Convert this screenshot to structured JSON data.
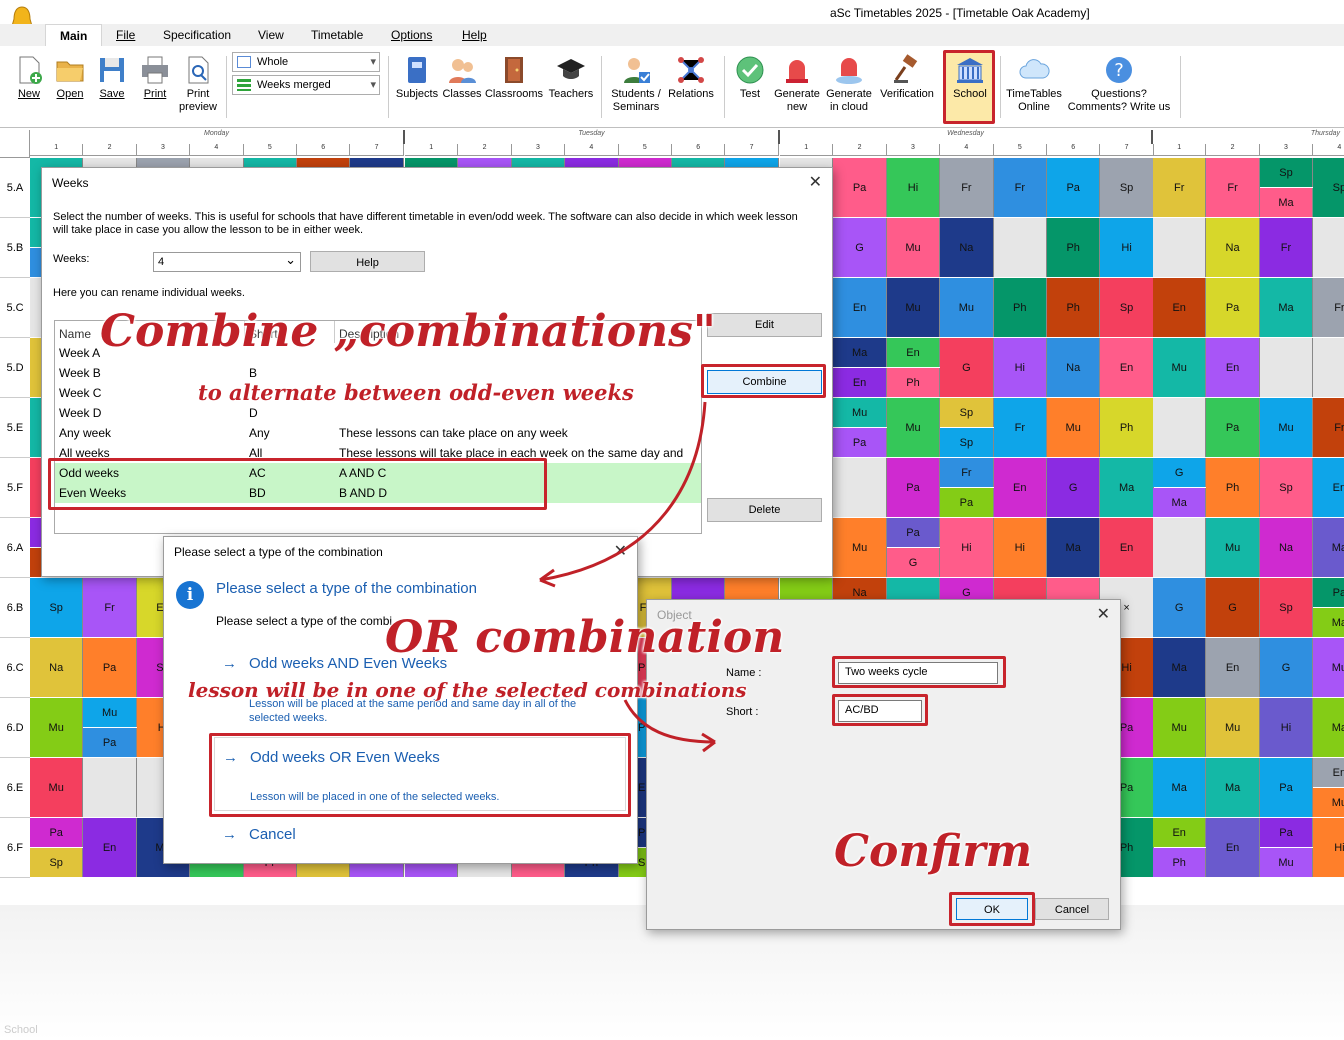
{
  "app": {
    "title": "aSc Timetables 2025  -  [Timetable Oak Academy]"
  },
  "menu_tabs": [
    "Main",
    "File",
    "Specification",
    "View",
    "Timetable",
    "Options",
    "Help"
  ],
  "ribbon": {
    "new": "New",
    "open": "Open",
    "save": "Save",
    "print": "Print",
    "print_preview_1": "Print",
    "print_preview_2": "preview",
    "combo_whole": "Whole",
    "combo_weeks": "Weeks merged",
    "subjects": "Subjects",
    "classes": "Classes",
    "classrooms": "Classrooms",
    "teachers": "Teachers",
    "students_1": "Students /",
    "students_2": "Seminars",
    "relations": "Relations",
    "test": "Test",
    "generate_new_1": "Generate",
    "generate_new_2": "new",
    "generate_cloud_1": "Generate",
    "generate_cloud_2": "in cloud",
    "verification": "Verification",
    "school": "School",
    "online_1": "TimeTables",
    "online_2": "Online",
    "questions_1": "Questions?",
    "questions_2": "Comments? Write us"
  },
  "grid": {
    "days": [
      "Monday",
      "Tuesday",
      "Wednesday",
      "Thursday"
    ],
    "periods": [
      "1",
      "2",
      "3",
      "4",
      "5",
      "6",
      "7"
    ],
    "classes": [
      "5.A",
      "5.B",
      "5.C",
      "5.D",
      "5.E",
      "5.F",
      "6.A",
      "6.B",
      "6.C",
      "6.D",
      "6.E",
      "6.F"
    ]
  },
  "weeks_dialog": {
    "title": "Weeks",
    "description": "Select the number of weeks. This is useful for schools that have different timetable in even/odd week. The software can also decide in which week lesson will take place in case you allow the lesson to be in either week.",
    "weeks_label": "Weeks:",
    "weeks_value": "4",
    "help": "Help",
    "rename_label": "Here you can rename individual weeks.",
    "edit": "Edit",
    "combine": "Combine",
    "delete": "Delete",
    "columns": [
      "Name",
      "Short",
      "Description"
    ],
    "rows": [
      {
        "name": "Week A",
        "short": "",
        "desc": ""
      },
      {
        "name": "Week B",
        "short": "B",
        "desc": ""
      },
      {
        "name": "Week C",
        "short": "",
        "desc": ""
      },
      {
        "name": "Week D",
        "short": "D",
        "desc": ""
      },
      {
        "name": "Any week",
        "short": "Any",
        "desc": "These lessons can take place on any week"
      },
      {
        "name": "All weeks",
        "short": "All",
        "desc": "These lessons will take place in each week on the same day and pe..."
      },
      {
        "name": "Odd weeks",
        "short": "AC",
        "desc": "A AND C"
      },
      {
        "name": "Even Weeks",
        "short": "BD",
        "desc": "B AND D"
      }
    ]
  },
  "combination_dialog": {
    "title": "Please select a type of the combination",
    "heading": "Please select a type of the combination",
    "subheading": "Please select a type of the combi",
    "and_option": "Odd weeks AND Even Weeks",
    "and_desc_1": "Lesson will be placed at the same period and same day in all of the",
    "and_desc_2": "selected weeks.",
    "or_option": "Odd weeks OR Even Weeks",
    "or_desc": "Lesson will be placed in one of the selected weeks.",
    "cancel": "Cancel"
  },
  "object_dialog": {
    "title": "Object",
    "name_label": "Name :",
    "name_value": "Two weeks cycle",
    "short_label": "Short :",
    "short_value": "AC/BD",
    "ok": "OK",
    "cancel": "Cancel"
  },
  "annotations": {
    "combine_title": "Combine „combinations\"",
    "combine_sub": "to alternate between odd-even weeks",
    "or_title": "OR combination",
    "or_sub": "lesson will be in one of the selected combinations",
    "confirm": "Confirm"
  },
  "bottom": {
    "school_label": "School"
  },
  "colors": {
    "highlight": "#c8242c",
    "link": "#1b5fb1",
    "selected_row": "#c8f6c8"
  }
}
